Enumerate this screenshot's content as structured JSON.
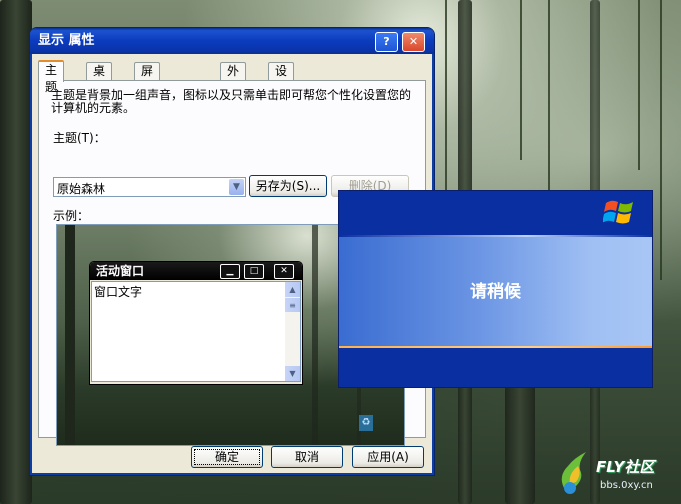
{
  "window": {
    "title": "显示 属性",
    "help_btn": "?",
    "close_btn": "✕"
  },
  "tabs": [
    {
      "label": "主题"
    },
    {
      "label": "桌面"
    },
    {
      "label": "屏幕保护程序"
    },
    {
      "label": "外观"
    },
    {
      "label": "设置"
    }
  ],
  "theme_tab": {
    "description": "主题是背景加一组声音，图标以及只需单击即可帮您个性化设置您的计算机的元素。",
    "theme_label": "主题(T)：",
    "theme_value": "原始森林",
    "save_as": "另存为(S)...",
    "delete": "删除(D)",
    "sample_label": "示例："
  },
  "preview": {
    "window_title": "活动窗口",
    "window_text": "窗口文字"
  },
  "footer": {
    "ok": "确定",
    "cancel": "取消",
    "apply": "应用(A)"
  },
  "wait_screen": {
    "message": "请稍候"
  },
  "watermark": {
    "brand": "FLY社区",
    "url": "bbs.0xy.cn"
  },
  "colors": {
    "title_blue": "#0b3bbd",
    "tab_accent": "#e68b2c",
    "wait_blue": "#0a2fa0"
  }
}
